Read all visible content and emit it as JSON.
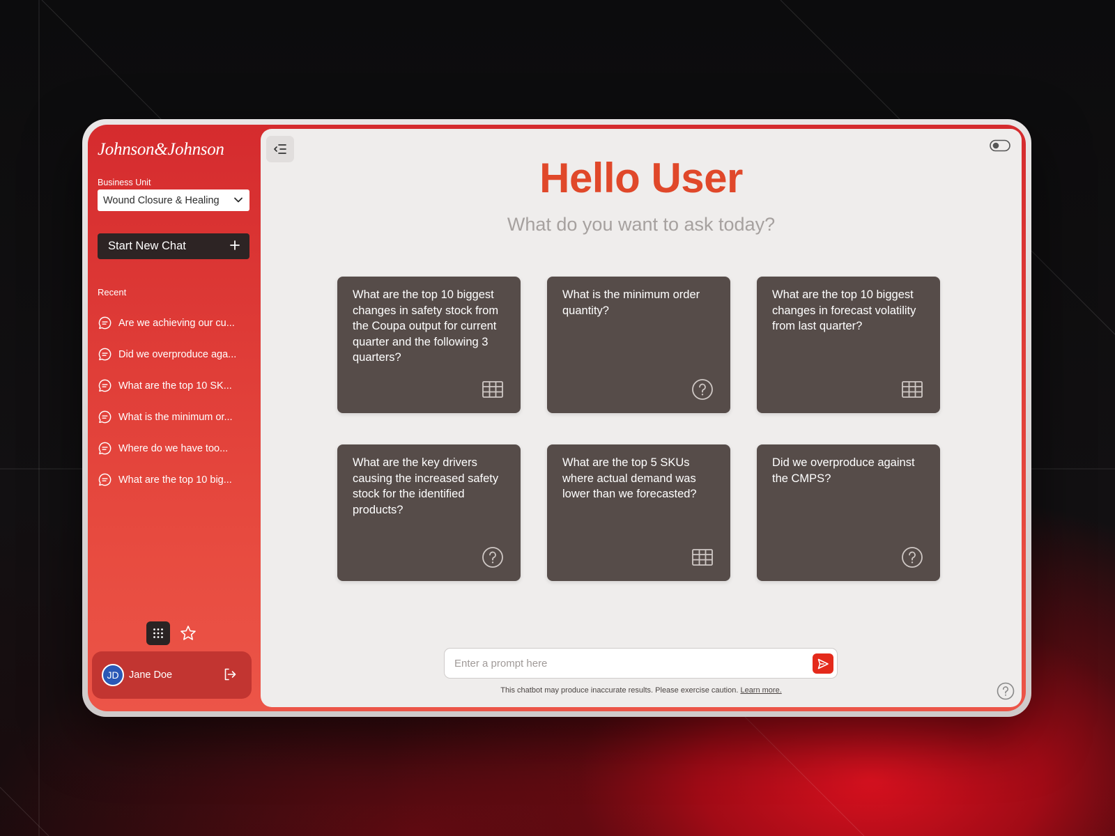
{
  "sidebar": {
    "brand": "Johnson&Johnson",
    "business_unit_label": "Business Unit",
    "business_unit_value": "Wound Closure & Healing",
    "new_chat_label": "Start New Chat",
    "recent_label": "Recent",
    "recent_items": [
      "Are we achieving our cu...",
      "Did we overproduce aga...",
      "What are the top 10 SK...",
      "What is the minimum or...",
      "Where do we have too...",
      "What are the top 10 big..."
    ],
    "user": {
      "initials": "JD",
      "name": "Jane Doe"
    }
  },
  "main": {
    "title": "Hello User",
    "subtitle": "What do you want to ask today?",
    "cards": [
      {
        "text": "What are the top 10 biggest changes in safety stock from the Coupa output for current quarter and the following 3 quarters?",
        "icon": "table-icon"
      },
      {
        "text": "What is the minimum order quantity?",
        "icon": "question-icon"
      },
      {
        "text": "What are the top 10 biggest changes in forecast volatility from last quarter?",
        "icon": "table-icon"
      },
      {
        "text": "What are the key drivers causing the increased safety stock for the identified products?",
        "icon": "question-icon"
      },
      {
        "text": "What are the top 5 SKUs where actual demand was lower than we forecasted?",
        "icon": "table-icon"
      },
      {
        "text": "Did we overproduce against the CMPS?",
        "icon": "question-icon"
      }
    ],
    "prompt_placeholder": "Enter a prompt here",
    "disclaimer": "This chatbot may produce inaccurate results. Please exercise caution.",
    "learn_more": "Learn more."
  },
  "colors": {
    "sidebar_red": "#d52b2e",
    "title_orange": "#e0482a",
    "card_bg": "#564c49",
    "send_red": "#e42a1b",
    "avatar_blue": "#2a58b6"
  }
}
